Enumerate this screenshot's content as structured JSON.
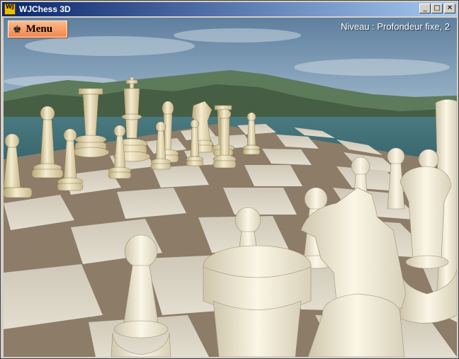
{
  "window": {
    "title": "WJChess 3D",
    "icon_text": "WJ",
    "buttons": {
      "minimize": "_",
      "maximize": "□",
      "close": "✕"
    }
  },
  "hud": {
    "menu_label": "Menu",
    "menu_icon": "♚",
    "level_text": "Niveau : Profondeur fixe, 2"
  },
  "colors": {
    "piece_ivory": "#e8dcb4",
    "board_light": "#d8d2c4",
    "board_dark": "#7a6a58",
    "sky": "#6f8fab",
    "sea": "#3e6c72"
  }
}
